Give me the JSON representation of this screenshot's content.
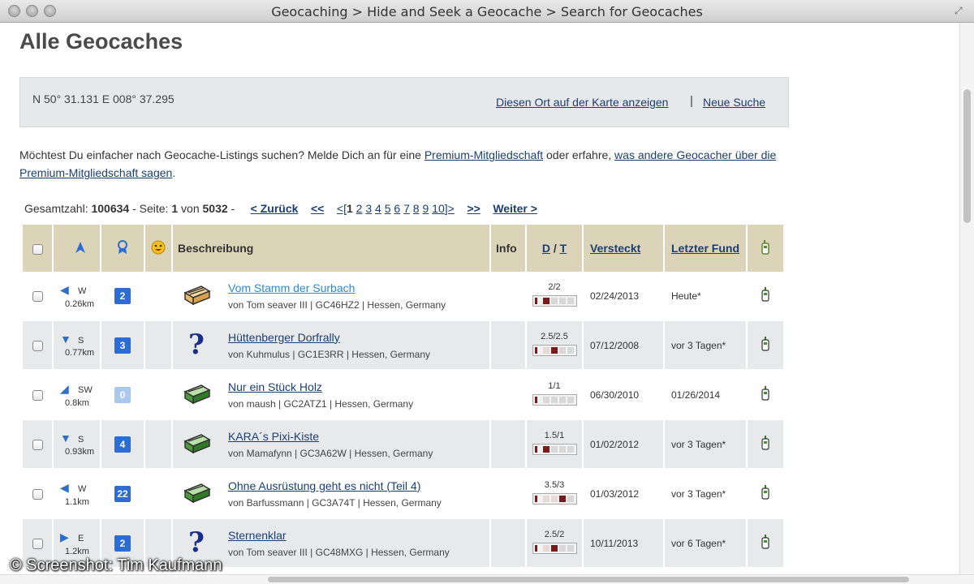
{
  "window": {
    "title": "Geocaching > Hide and Seek a Geocache > Search for Geocaches"
  },
  "page": {
    "title": "Alle Geocaches"
  },
  "search": {
    "coordinates": "N 50° 31.131 E 008° 37.295",
    "map_link": "Diesen Ort auf der Karte anzeigen",
    "separator": "|",
    "new_search": "Neue Suche"
  },
  "promo": {
    "text_before": "Möchtest Du einfacher nach Geocache-Listings suchen? Melde Dich an für eine ",
    "premium_link": "Premium-Mitgliedschaft",
    "text_middle": " oder erfahre, ",
    "opinions_link": "was andere Geocacher über die Premium-Mitgliedschaft sagen",
    "text_after": "."
  },
  "pager": {
    "total_label": "Gesamtzahl: ",
    "total": "100634",
    "page_label": " - Seite: ",
    "page": "1",
    "of_label": " von ",
    "pages": "5032",
    "dash": " -",
    "back": "< Zurück",
    "first": "<<",
    "open_bracket": "<[",
    "current": "1",
    "numbers": [
      "2",
      "3",
      "4",
      "5",
      "6",
      "7",
      "8",
      "9",
      "10"
    ],
    "close_bracket": "]>",
    "last": ">>",
    "next": "Weiter >"
  },
  "table": {
    "headers": {
      "description": "Beschreibung",
      "info": "Info",
      "d": "D",
      "slash": " / ",
      "t": "T",
      "hidden": "Versteckt",
      "last_found": "Letzter Fund"
    },
    "rows": [
      {
        "arrow": "◀",
        "heading": "W",
        "distance": "0.26km",
        "favorites": "2",
        "type": "traditional",
        "name": "Vom Stamm der Surbach",
        "visited": true,
        "meta": "von Tom seaver III | GC46HZ2 | Hessen, Germany",
        "dt": "2/2",
        "difficulty": 2,
        "terrain": 2,
        "hidden": "02/24/2013",
        "last_found": "Heute*"
      },
      {
        "arrow": "▼",
        "heading": "S",
        "distance": "0.77km",
        "favorites": "3",
        "type": "mystery",
        "name": "Hüttenberger Dorfrally",
        "visited": false,
        "meta": "von Kuhmulus | GC1E3RR | Hessen, Germany",
        "dt": "2.5/2.5",
        "difficulty": 2.5,
        "terrain": 2.5,
        "hidden": "07/12/2008",
        "last_found": "vor 3 Tagen*"
      },
      {
        "arrow": "◢",
        "heading": "SW",
        "distance": "0.8km",
        "favorites": "0",
        "type": "traditional-green",
        "name": "Nur ein Stück Holz",
        "visited": false,
        "meta": "von maush | GC2ATZ1 | Hessen, Germany",
        "dt": "1/1",
        "difficulty": 1,
        "terrain": 1,
        "hidden": "06/30/2010",
        "last_found": "01/26/2014"
      },
      {
        "arrow": "▼",
        "heading": "S",
        "distance": "0.93km",
        "favorites": "4",
        "type": "traditional-green",
        "name": "KARA´s Pixi-Kiste",
        "visited": false,
        "meta": "von Mamafynn | GC3A62W | Hessen, Germany",
        "dt": "1.5/1",
        "difficulty": 1.5,
        "terrain": 1,
        "hidden": "01/02/2012",
        "last_found": "vor 3 Tagen*"
      },
      {
        "arrow": "◀",
        "heading": "W",
        "distance": "1.1km",
        "favorites": "22",
        "type": "traditional-green",
        "name": "Ohne Ausrüstung geht es nicht (Teil 4)",
        "visited": false,
        "meta": "von Barfussmann | GC3A74T | Hessen, Germany",
        "dt": "3.5/3",
        "difficulty": 3.5,
        "terrain": 3,
        "hidden": "01/03/2012",
        "last_found": "vor 3 Tagen*"
      },
      {
        "arrow": "▶",
        "heading": "E",
        "distance": "1.2km",
        "favorites": "2",
        "type": "mystery",
        "name": "Sternenklar",
        "visited": false,
        "meta": "von Tom seaver III | GC48MXG | Hessen, Germany",
        "dt": "2.5/2",
        "difficulty": 2.5,
        "terrain": 2,
        "hidden": "10/11/2013",
        "last_found": "vor 6 Tagen*"
      }
    ]
  },
  "watermark": "© Screenshot: Tim Kaufmann",
  "colors": {
    "header_bg": "#dcd4b8",
    "link": "#1a3f75",
    "badge": "#2b6cd6",
    "bar_dark": "#7a1a1a"
  }
}
